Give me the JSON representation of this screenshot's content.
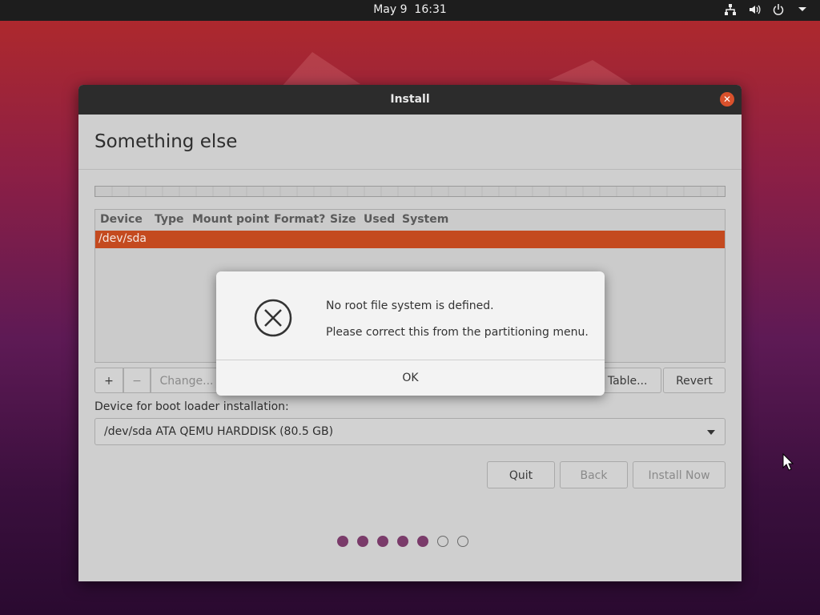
{
  "topbar": {
    "date": "May 9",
    "time": "16:31",
    "icons": [
      "network-icon",
      "volume-icon",
      "power-icon",
      "dropdown-arrow-icon"
    ]
  },
  "window": {
    "title": "Install",
    "heading": "Something else",
    "table": {
      "columns": [
        "Device",
        "Type",
        "Mount point",
        "Format?",
        "Size",
        "Used",
        "System"
      ],
      "rows": [
        {
          "device": "/dev/sda",
          "selected": true
        }
      ]
    },
    "buttons": {
      "add": "+",
      "remove": "−",
      "change": "Change...",
      "new_table": "n Table...",
      "revert": "Revert"
    },
    "boot_loader_label": "Device for boot loader installation:",
    "boot_loader_value": "/dev/sda ATA QEMU HARDDISK (80.5 GB)",
    "actions": {
      "quit": "Quit",
      "back": "Back",
      "install_now": "Install Now"
    },
    "progress": {
      "total_steps": 7,
      "completed_steps": 5
    }
  },
  "dialog": {
    "icon": "error-circle-x-icon",
    "message1": "No root file system is defined.",
    "message2": "Please correct this from the partitioning menu.",
    "ok": "OK"
  },
  "colors": {
    "selection": "#c44a1f",
    "close_button": "#d9512c",
    "progress_dot": "#7a3b6a"
  }
}
